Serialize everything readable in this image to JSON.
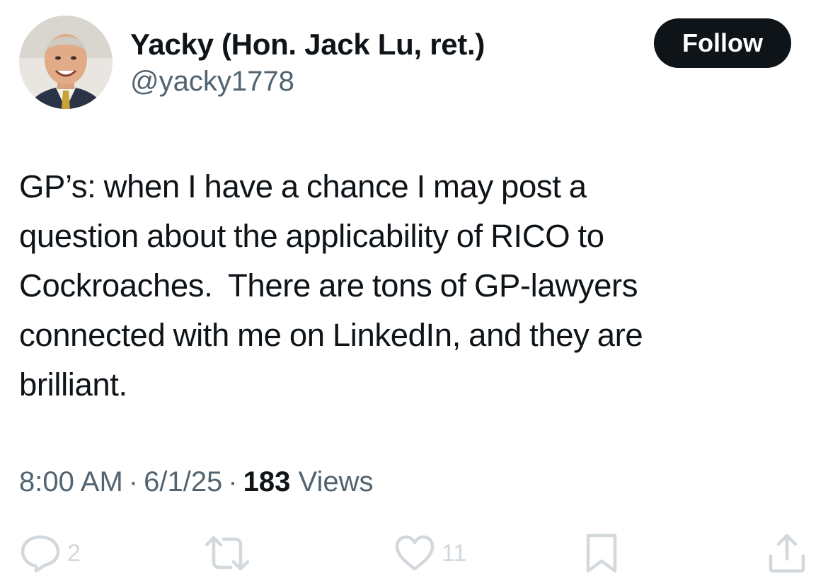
{
  "author": {
    "display_name": "Yacky (Hon. Jack Lu, ret.)",
    "handle": "@yacky1778",
    "avatar_icon": "profile-photo"
  },
  "follow_button": {
    "label": "Follow"
  },
  "tweet": {
    "lines": [
      "GP’s: when I have a chance I may post a",
      "question about the applicability of RICO to",
      "Cockroaches.  There are tons of GP-lawyers",
      "connected with me on LinkedIn, and they are",
      "brilliant."
    ]
  },
  "meta": {
    "time": "8:00 AM",
    "separator": "·",
    "date": "6/1/25",
    "views_count": "183",
    "views_label": "Views"
  },
  "actions": {
    "reply": {
      "icon": "reply-icon",
      "count": "2"
    },
    "retweet": {
      "icon": "retweet-icon",
      "count": ""
    },
    "like": {
      "icon": "heart-icon",
      "count": "11"
    },
    "bookmark": {
      "icon": "bookmark-icon",
      "count": ""
    },
    "share": {
      "icon": "share-icon",
      "count": ""
    }
  },
  "colors": {
    "text_primary": "#0f1419",
    "text_secondary": "#536471",
    "action_icons": "#d2d8dc",
    "follow_button_bg": "#0f1419",
    "follow_button_text": "#ffffff"
  }
}
